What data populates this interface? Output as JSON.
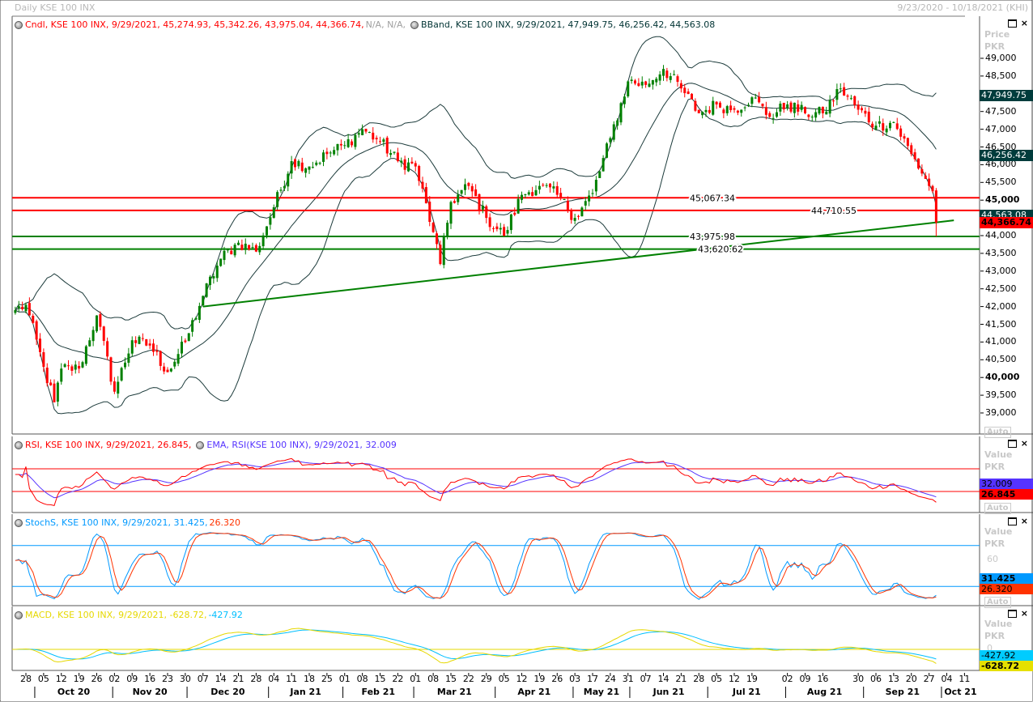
{
  "window": {
    "title": "Daily KSE 100 INX",
    "date_range": "9/23/2020 - 10/18/2021 (KHI)"
  },
  "panel_controls": {
    "maximize": "□",
    "close": "×"
  },
  "main": {
    "legend_candle": "Cndl, KSE 100 INX, 9/29/2021, 45,274.93, 45,342.26, 43,975.04, 44,366.74,",
    "legend_candle_na": "N/A, N/A,",
    "legend_bband": "BBand, KSE 100 INX, 9/29/2021, 47,949.75, 46,256.42, 44,563.08",
    "axis_title": "Price",
    "axis_unit": "PKR",
    "auto_label": "Auto",
    "y_ticks": [
      "49,000",
      "48,500",
      "48,000",
      "47,500",
      "47,000",
      "46,500",
      "46,000",
      "45,500",
      "45,000",
      "44,500",
      "44,000",
      "43,500",
      "43,000",
      "42,500",
      "42,000",
      "41,500",
      "41,000",
      "40,500",
      "40,000",
      "39,500",
      "39,000"
    ],
    "badges": [
      {
        "value": "47,949.75",
        "price": 47949.75,
        "bg": "#003c3c",
        "fg": "#ffffff",
        "bold": false
      },
      {
        "value": "46,256.42",
        "price": 46256.42,
        "bg": "#003c3c",
        "fg": "#ffffff",
        "bold": false
      },
      {
        "value": "44,563.08",
        "price": 44563.08,
        "bg": "#003c3c",
        "fg": "#ffffff",
        "bold": false
      },
      {
        "value": "44,366.74",
        "price": 44366.74,
        "bg": "#ff0000",
        "fg": "#000000",
        "bold": true
      }
    ],
    "hlines": [
      {
        "label": "45,067.34",
        "price": 45067.34,
        "color": "#ff0000"
      },
      {
        "label": "44,710.55",
        "price": 44710.55,
        "color": "#ff0000"
      },
      {
        "label": "43,975.98",
        "price": 43975.98,
        "color": "#008000"
      },
      {
        "label": "43,620.62",
        "price": 43620.62,
        "color": "#008000"
      }
    ],
    "trendline": {
      "from": [
        "2020-12-07",
        42000
      ],
      "to": [
        "2021-10-06",
        44430
      ],
      "color": "#008000"
    }
  },
  "rsi": {
    "legend_rsi": "RSI, KSE 100 INX, 9/29/2021, 26.845,",
    "legend_ema": "EMA, RSI(KSE 100 INX), 9/29/2021, 32.009",
    "axis_title": "Value",
    "axis_unit": "PKR",
    "auto_label": "Auto",
    "levels": [
      70,
      30
    ],
    "badges": [
      {
        "value": "32.009",
        "bg": "#5533ff",
        "fg": "#000",
        "bold": false
      },
      {
        "value": "26.845",
        "bg": "#ff0000",
        "fg": "#000",
        "bold": true
      }
    ]
  },
  "stoch": {
    "legend_main": "StochS, KSE 100 INX, 9/29/2021, 31.425,",
    "legend_d": "26.320",
    "axis_title": "Value",
    "axis_unit": "PKR",
    "tick": "60",
    "auto_label": "Auto",
    "levels": [
      80,
      20
    ],
    "badges": [
      {
        "value": "31.425",
        "bg": "#0099ff",
        "fg": "#000",
        "bold": true
      },
      {
        "value": "26.320",
        "bg": "#ff3300",
        "fg": "#000",
        "bold": false
      }
    ]
  },
  "macd": {
    "legend_main": "MACD, KSE 100 INX, 9/29/2021, -628.72,",
    "legend_signal": "-427.92",
    "axis_title": "Value",
    "axis_unit": "PKR",
    "tick": "0",
    "badges": [
      {
        "value": "-427.92",
        "bg": "#00ccff",
        "fg": "#000",
        "bold": false
      },
      {
        "value": "-628.72",
        "bg": "#e6e000",
        "fg": "#000",
        "bold": true
      }
    ]
  },
  "colors": {
    "up": "#008000",
    "down": "#ff0000",
    "bband": "#1c3b3b",
    "rsi": "#ff0000",
    "rsi_ema": "#5533ff",
    "stoch_k": "#0099ff",
    "stoch_d": "#ff3300",
    "macd": "#e6d800",
    "macd_signal": "#00bfff"
  },
  "chart_data": {
    "type": "candlestick",
    "instrument": "KSE 100 INX",
    "period": "Daily",
    "last_candle": {
      "date": "9/29/2021",
      "open": 45274.93,
      "high": 45342.26,
      "low": 43975.04,
      "close": 44366.74
    },
    "ylim": [
      38700,
      49500
    ],
    "approx_closes": [
      [
        "2020-09-23",
        41900
      ],
      [
        "2020-09-28",
        42050
      ],
      [
        "2020-10-05",
        40300
      ],
      [
        "2020-10-08",
        39300
      ],
      [
        "2020-10-12",
        40250
      ],
      [
        "2020-10-19",
        40250
      ],
      [
        "2020-10-26",
        41750
      ],
      [
        "2020-11-02",
        39600
      ],
      [
        "2020-11-09",
        41050
      ],
      [
        "2020-11-16",
        40900
      ],
      [
        "2020-11-23",
        40150
      ],
      [
        "2020-11-30",
        41000
      ],
      [
        "2020-12-07",
        42300
      ],
      [
        "2020-12-14",
        43350
      ],
      [
        "2020-12-21",
        43800
      ],
      [
        "2020-12-28",
        43550
      ],
      [
        "2021-01-04",
        44800
      ],
      [
        "2021-01-11",
        46100
      ],
      [
        "2021-01-18",
        45950
      ],
      [
        "2021-01-25",
        46300
      ],
      [
        "2021-02-01",
        46550
      ],
      [
        "2021-02-08",
        47000
      ],
      [
        "2021-02-15",
        46650
      ],
      [
        "2021-02-22",
        46100
      ],
      [
        "2021-03-01",
        45950
      ],
      [
        "2021-03-08",
        44100
      ],
      [
        "2021-03-10",
        43200
      ],
      [
        "2021-03-15",
        44950
      ],
      [
        "2021-03-22",
        45400
      ],
      [
        "2021-03-29",
        44500
      ],
      [
        "2021-04-05",
        44000
      ],
      [
        "2021-04-12",
        45150
      ],
      [
        "2021-04-19",
        45400
      ],
      [
        "2021-04-26",
        45150
      ],
      [
        "2021-05-03",
        44500
      ],
      [
        "2021-05-17",
        45200
      ],
      [
        "2021-05-24",
        46750
      ],
      [
        "2021-05-31",
        48350
      ],
      [
        "2021-06-07",
        48250
      ],
      [
        "2021-06-14",
        48700
      ],
      [
        "2021-06-21",
        48150
      ],
      [
        "2021-06-28",
        47450
      ],
      [
        "2021-07-05",
        47700
      ],
      [
        "2021-07-12",
        47550
      ],
      [
        "2021-07-19",
        47900
      ],
      [
        "2021-07-26",
        47350
      ],
      [
        "2021-08-02",
        47700
      ],
      [
        "2021-08-09",
        47450
      ],
      [
        "2021-08-16",
        47450
      ],
      [
        "2021-08-23",
        48150
      ],
      [
        "2021-08-30",
        47550
      ],
      [
        "2021-09-06",
        47100
      ],
      [
        "2021-09-13",
        47200
      ],
      [
        "2021-09-20",
        46300
      ],
      [
        "2021-09-24",
        45600
      ],
      [
        "2021-09-28",
        45250
      ],
      [
        "2021-09-29",
        44366.74
      ]
    ],
    "bollinger": {
      "period": 20,
      "std": 2,
      "last": {
        "upper": 47949.75,
        "middle": 46256.42,
        "lower": 44563.08
      }
    },
    "rsi": {
      "last": 26.845,
      "ema_last": 32.009,
      "ylim": [
        0,
        100
      ]
    },
    "stochastic": {
      "k_last": 31.425,
      "d_last": 26.32,
      "ylim": [
        0,
        100
      ]
    },
    "macd": {
      "macd_last": -628.72,
      "signal_last": -427.92
    },
    "x_ticks": [
      [
        "28",
        "2020-09-28"
      ],
      [
        "05",
        "2020-10-05"
      ],
      [
        "12",
        "2020-10-12"
      ],
      [
        "19",
        "2020-10-19"
      ],
      [
        "26",
        "2020-10-26"
      ],
      [
        "02",
        "2020-11-02"
      ],
      [
        "09",
        "2020-11-09"
      ],
      [
        "16",
        "2020-11-16"
      ],
      [
        "23",
        "2020-11-23"
      ],
      [
        "30",
        "2020-11-30"
      ],
      [
        "07",
        "2020-12-07"
      ],
      [
        "14",
        "2020-12-14"
      ],
      [
        "21",
        "2020-12-21"
      ],
      [
        "28",
        "2020-12-28"
      ],
      [
        "04",
        "2021-01-04"
      ],
      [
        "11",
        "2021-01-11"
      ],
      [
        "18",
        "2021-01-18"
      ],
      [
        "25",
        "2021-01-25"
      ],
      [
        "01",
        "2021-02-01"
      ],
      [
        "08",
        "2021-02-08"
      ],
      [
        "15",
        "2021-02-15"
      ],
      [
        "22",
        "2021-02-22"
      ],
      [
        "01",
        "2021-03-01"
      ],
      [
        "08",
        "2021-03-08"
      ],
      [
        "15",
        "2021-03-15"
      ],
      [
        "22",
        "2021-03-22"
      ],
      [
        "29",
        "2021-03-29"
      ],
      [
        "05",
        "2021-04-05"
      ],
      [
        "12",
        "2021-04-12"
      ],
      [
        "19",
        "2021-04-19"
      ],
      [
        "26",
        "2021-04-26"
      ],
      [
        "03",
        "2021-05-03"
      ],
      [
        "17",
        "2021-05-17"
      ],
      [
        "24",
        "2021-05-24"
      ],
      [
        "31",
        "2021-05-31"
      ],
      [
        "07",
        "2021-06-07"
      ],
      [
        "14",
        "2021-06-14"
      ],
      [
        "21",
        "2021-06-21"
      ],
      [
        "28",
        "2021-06-28"
      ],
      [
        "05",
        "2021-07-05"
      ],
      [
        "12",
        "2021-07-12"
      ],
      [
        "19",
        "2021-07-19"
      ],
      [
        "02",
        "2021-08-02"
      ],
      [
        "09",
        "2021-08-09"
      ],
      [
        "16",
        "2021-08-16"
      ],
      [
        "30",
        "2021-08-30"
      ],
      [
        "06",
        "2021-09-06"
      ],
      [
        "13",
        "2021-09-13"
      ],
      [
        "20",
        "2021-09-20"
      ],
      [
        "27",
        "2021-09-27"
      ],
      [
        "04",
        "2021-10-04"
      ],
      [
        "11",
        "2021-10-11"
      ]
    ],
    "months": [
      [
        "Oct 20",
        "2020-10-01"
      ],
      [
        "Nov 20",
        "2020-11-02"
      ],
      [
        "Dec 20",
        "2020-12-01"
      ],
      [
        "Jan 21",
        "2021-01-01"
      ],
      [
        "Feb 21",
        "2021-02-01"
      ],
      [
        "Mar 21",
        "2021-03-01"
      ],
      [
        "Apr 21",
        "2021-04-01"
      ],
      [
        "May 21",
        "2021-05-03"
      ],
      [
        "Jun 21",
        "2021-06-01"
      ],
      [
        "Jul 21",
        "2021-07-01"
      ],
      [
        "Aug 21",
        "2021-08-02"
      ],
      [
        "Sep 21",
        "2021-09-01"
      ],
      [
        "Oct 21",
        "2021-10-01"
      ]
    ]
  }
}
